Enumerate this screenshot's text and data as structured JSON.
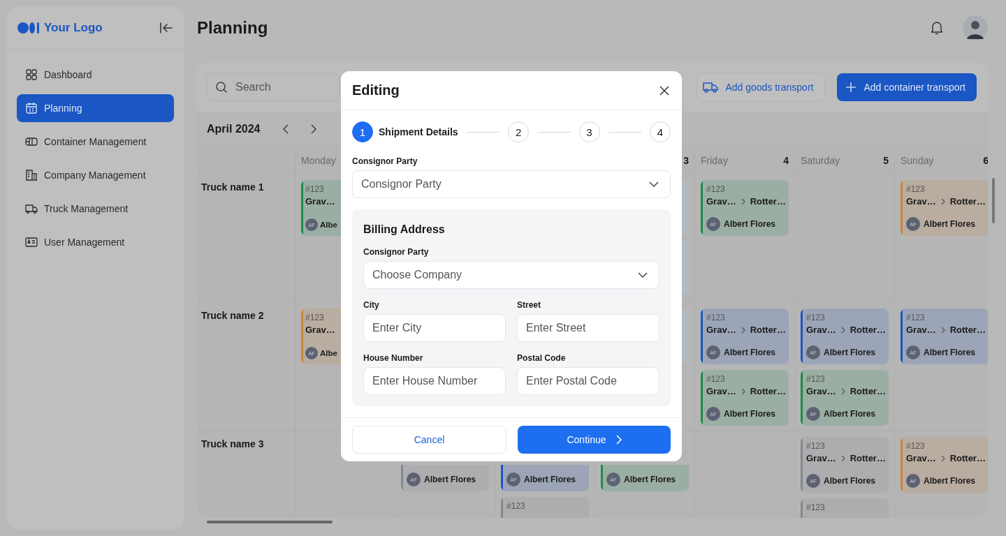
{
  "sidebar": {
    "logo": "Your Logo",
    "items": [
      {
        "label": "Dashboard",
        "selected": false
      },
      {
        "label": "Planning",
        "selected": true
      },
      {
        "label": "Container Management",
        "selected": false
      },
      {
        "label": "Company Management",
        "selected": false
      },
      {
        "label": "Truck Management",
        "selected": false
      },
      {
        "label": "User Management",
        "selected": false
      }
    ]
  },
  "header": {
    "title": "Planning"
  },
  "toolbar": {
    "search": {
      "placeholder": "Search"
    },
    "buttons": [
      {
        "label": "Add goods transport",
        "kind": "secondary"
      },
      {
        "label": "Add container transport",
        "kind": "primary"
      }
    ]
  },
  "month": "April 2024",
  "days": [
    {
      "name": "Monday"
    },
    {
      "number": "3"
    },
    {
      "name": "Friday",
      "number": "4"
    },
    {
      "name": "Saturday",
      "number": "5"
    },
    {
      "name": "Sunday",
      "number": "6"
    }
  ],
  "rows": [
    {
      "truck": "Truck name 1",
      "cells": [
        [
          {
            "kind": "left",
            "color": "#1b8c48",
            "id": "#123",
            "from": "Grav…",
            "driver": "Albe",
            "initials": "AF"
          }
        ],
        [],
        [],
        [
          {
            "kind": "sliver"
          },
          {
            "kind": "sliver"
          }
        ],
        [
          {
            "kind": "full",
            "color": "#1b8c48",
            "id": "#123",
            "from": "Grav…",
            "to": "Rotter…",
            "driver": "Albert Flores",
            "initials": "AF"
          }
        ],
        [],
        [
          {
            "kind": "full",
            "color": "#cf8236",
            "id": "#123",
            "from": "Grav…",
            "to": "Rotter…",
            "driver": "Albert Flores",
            "initials": "AF"
          }
        ]
      ]
    },
    {
      "truck": "Truck name 2",
      "cells": [
        [
          {
            "kind": "left",
            "color": "#cf8236",
            "id": "#123",
            "from": "Grav…",
            "driver": "Albe",
            "initials": "AF"
          }
        ],
        [],
        [],
        [
          {
            "kind": "sliver"
          }
        ],
        [
          {
            "kind": "full",
            "color": "#1a56c4",
            "id": "#123",
            "from": "Grav…",
            "to": "Rotter…",
            "driver": "Albert Flores",
            "initials": "AF"
          },
          {
            "kind": "full",
            "color": "#1b8c48",
            "id": "#123",
            "from": "Grav…",
            "to": "Rotter…",
            "driver": "Albert Flores",
            "initials": "AF"
          }
        ],
        [
          {
            "kind": "full",
            "color": "#1a56c4",
            "id": "#123",
            "from": "Grav…",
            "to": "Rotter…",
            "driver": "Albert Flores",
            "initials": "AF"
          },
          {
            "kind": "full",
            "color": "#1b8c48",
            "id": "#123",
            "from": "Grav…",
            "to": "Rotter…",
            "driver": "Albert Flores",
            "initials": "AF"
          }
        ],
        [
          {
            "kind": "full",
            "color": "#1a56c4",
            "id": "#123",
            "from": "Grav…",
            "to": "Rotter…",
            "driver": "Albert Flores",
            "initials": "AF"
          }
        ]
      ]
    },
    {
      "truck": "Truck name 3",
      "cells": [
        [],
        [
          {
            "kind": "bottom",
            "color": "#85888f",
            "driver": "Albert Flores",
            "initials": "AF"
          }
        ],
        [
          {
            "kind": "bottom",
            "color": "#1a56c4",
            "driver": "Albert Flores",
            "initials": "AF"
          },
          {
            "kind": "full",
            "color": "#85888f",
            "id": "#123"
          }
        ],
        [
          {
            "kind": "bottom",
            "color": "#1b8c48",
            "driver": "Albert Flores",
            "initials": "AF"
          }
        ],
        [],
        [
          {
            "kind": "full",
            "color": "#85888f",
            "id": "#123",
            "from": "Grav…",
            "to": "Rotter…",
            "driver": "Albert Flores",
            "initials": "AF"
          },
          {
            "kind": "full",
            "color": "#85888f",
            "id": "#123"
          }
        ],
        [
          {
            "kind": "full",
            "color": "#cf8236",
            "id": "#123",
            "from": "Grav…",
            "to": "Rotter…",
            "driver": "Albert Flores",
            "initials": "AF"
          }
        ]
      ]
    }
  ],
  "modal": {
    "title": "Editing",
    "steps": [
      {
        "number": "1",
        "label": "Shipment Details",
        "selected": true
      },
      {
        "number": "2",
        "selected": false
      },
      {
        "number": "3",
        "selected": false
      },
      {
        "number": "4",
        "selected": false
      }
    ],
    "consignor": {
      "label": "Consignor Party",
      "placeholder": "Consignor Party"
    },
    "billing": {
      "title": "Billing Address",
      "company": {
        "label": "Consignor Party",
        "placeholder": "Choose Company"
      },
      "fields": [
        {
          "label": "City",
          "placeholder": "Enter City"
        },
        {
          "label": "Street",
          "placeholder": "Enter Street"
        },
        {
          "label": "House Number",
          "placeholder": "Enter House Number"
        },
        {
          "label": "Postal Code",
          "placeholder": "Enter Postal Code"
        }
      ]
    },
    "cancel": "Cancel",
    "continue": "Continue"
  }
}
